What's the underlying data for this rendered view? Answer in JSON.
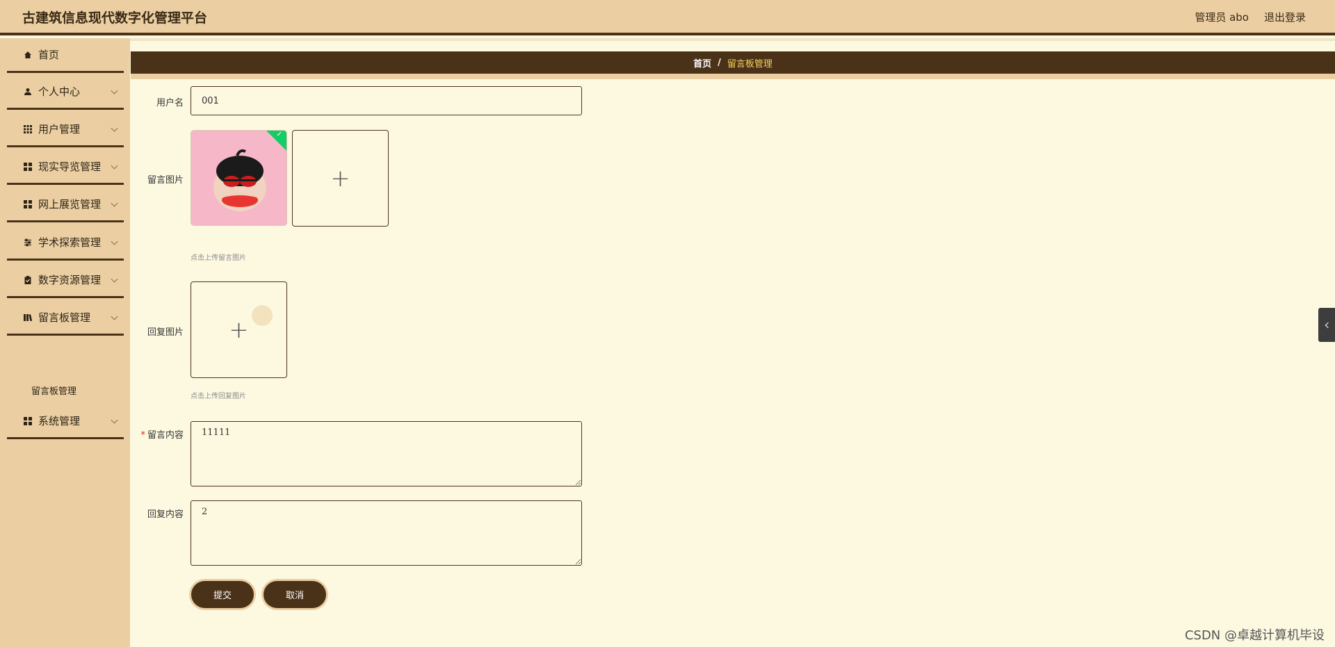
{
  "header": {
    "title": "古建筑信息现代数字化管理平台",
    "admin": "管理员 abo",
    "logout": "退出登录"
  },
  "sidebar": {
    "items": [
      {
        "label": "首页",
        "icon": "home-icon",
        "has_arrow": false
      },
      {
        "label": "个人中心",
        "icon": "person-icon",
        "has_arrow": true
      },
      {
        "label": "用户管理",
        "icon": "grid-icon",
        "has_arrow": true
      },
      {
        "label": "现实导览管理",
        "icon": "apps-icon",
        "has_arrow": true
      },
      {
        "label": "网上展览管理",
        "icon": "apps-icon",
        "has_arrow": true
      },
      {
        "label": "学术探索管理",
        "icon": "sliders-icon",
        "has_arrow": true
      },
      {
        "label": "数字资源管理",
        "icon": "clipboard-icon",
        "has_arrow": true
      },
      {
        "label": "留言板管理",
        "icon": "book-icon",
        "has_arrow": true
      },
      {
        "label": "系统管理",
        "icon": "apps-icon",
        "has_arrow": true
      }
    ],
    "submenu": "留言板管理"
  },
  "breadcrumb": {
    "home": "首页",
    "separator": "/",
    "current": "留言板管理"
  },
  "form": {
    "username_label": "用户名",
    "username_value": "001",
    "message_image_label": "留言图片",
    "message_image_tip": "点击上传留言图片",
    "reply_image_label": "回复图片",
    "reply_image_tip": "点击上传回复图片",
    "message_content_label": "留言内容",
    "message_content_value": "11111",
    "reply_content_label": "回复内容",
    "reply_content_value": "2",
    "required_mark": "*",
    "submit": "提交",
    "cancel": "取消"
  },
  "watermark": "CSDN @卓越计算机毕设",
  "colors": {
    "header_bg": "#ebcfa3",
    "dark_brown": "#4a3218",
    "main_bg": "#fdf9e1",
    "crumb_current": "#f7d25f",
    "success_green": "#13ce66"
  }
}
